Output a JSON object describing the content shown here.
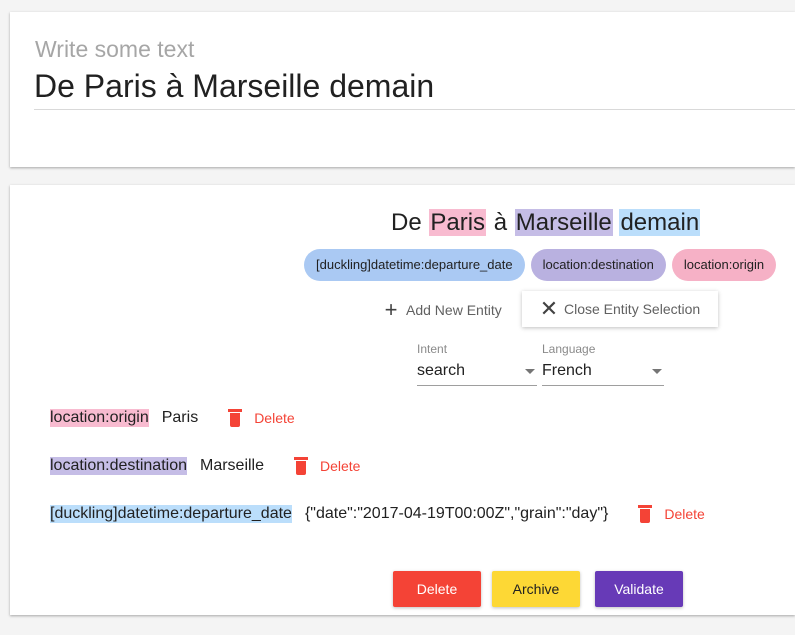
{
  "input": {
    "placeholder": "Write some text",
    "value": "De Paris à Marseille demain"
  },
  "sentence": {
    "parts": [
      "De",
      "Paris",
      "à",
      "Marseille",
      "demain"
    ]
  },
  "chips": [
    {
      "label": "[duckling]datetime:departure_date",
      "color": "#aac9f3"
    },
    {
      "label": "location:destination",
      "color": "#b9b1e0"
    },
    {
      "label": "location:origin",
      "color": "#f6b1c6"
    }
  ],
  "buttons": {
    "add_entity": "Add New Entity",
    "close_entity": "Close Entity Selection",
    "delete": "Delete",
    "archive": "Archive",
    "validate": "Validate"
  },
  "intent": {
    "label": "Intent",
    "value": "search"
  },
  "language": {
    "label": "Language",
    "value": "French"
  },
  "entities": [
    {
      "tag": "location:origin",
      "value": "Paris",
      "delete": "Delete"
    },
    {
      "tag": "location:destination",
      "value": "Marseille",
      "delete": "Delete"
    },
    {
      "tag": "[duckling]datetime:departure_date",
      "value": "{\"date\":\"2017-04-19T00:00Z\",\"grain\":\"day\"}",
      "delete": "Delete"
    }
  ],
  "colors": {
    "origin": "#f8bbd0",
    "destination": "#c5bde6",
    "datetime": "#bbdefb",
    "delete": "#f44336",
    "archive": "#fdd835",
    "validate": "#673ab7"
  },
  "icons": {
    "add": "plus-icon",
    "close": "close-icon",
    "delete": "trash-icon",
    "dropdown": "caret-down-icon"
  }
}
